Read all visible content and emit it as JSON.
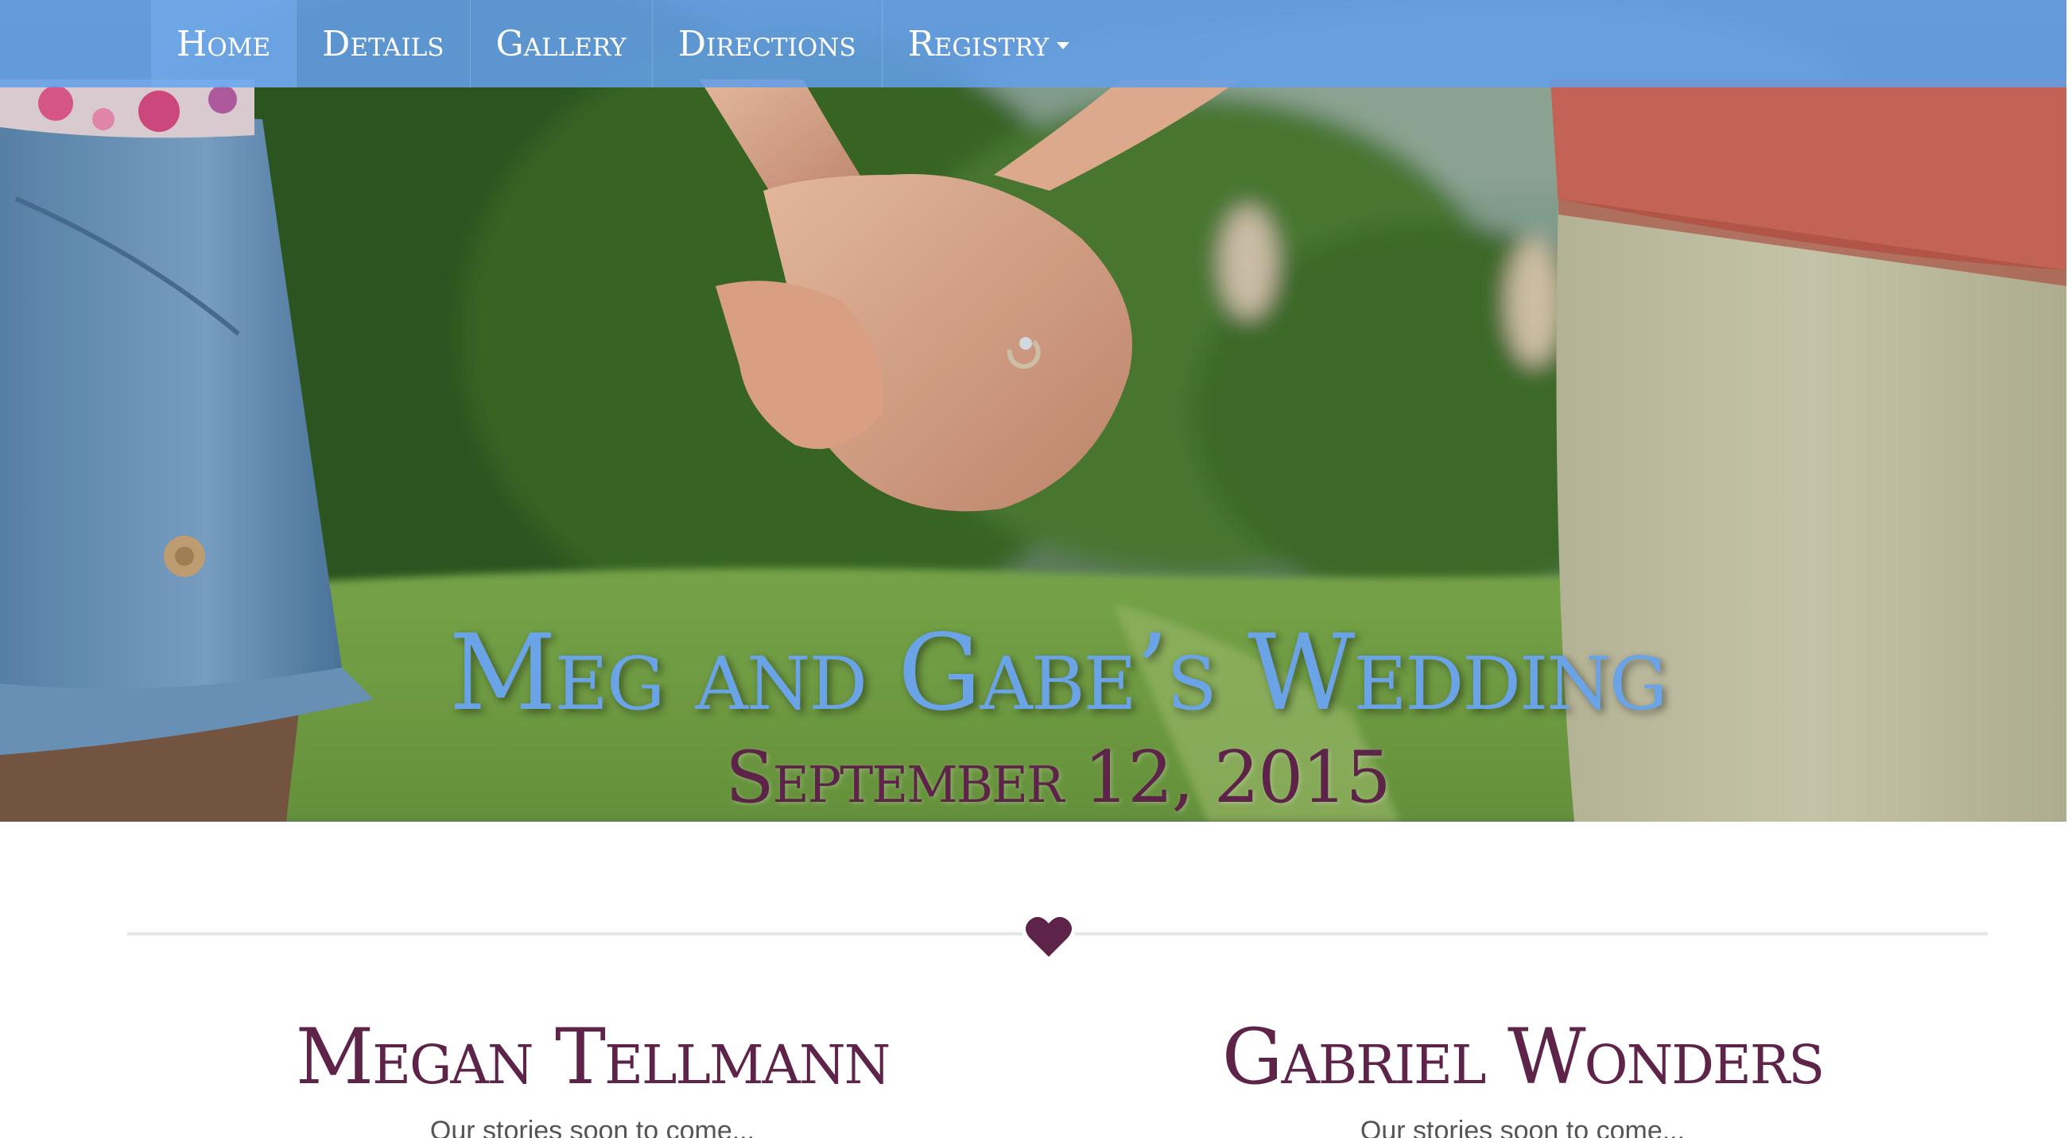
{
  "navbar": {
    "items": [
      {
        "label": "Home",
        "active": true
      },
      {
        "label": "Details",
        "active": false
      },
      {
        "label": "Gallery",
        "active": false
      },
      {
        "label": "Directions",
        "active": false
      },
      {
        "label": "Registry",
        "active": false,
        "dropdown": true
      }
    ],
    "background_color": "#639ee8"
  },
  "hero": {
    "title": "Meg and Gabe’s Wedding",
    "date": "September 12, 2015",
    "title_color": "#6aa4e6",
    "date_color": "#5e2348"
  },
  "divider": {
    "icon": "heart-icon",
    "icon_color": "#5e2348"
  },
  "profiles": [
    {
      "name": "Megan Tellmann",
      "text": "Our stories soon to come..."
    },
    {
      "name": "Gabriel Wonders",
      "text": "Our stories soon to come..."
    }
  ]
}
